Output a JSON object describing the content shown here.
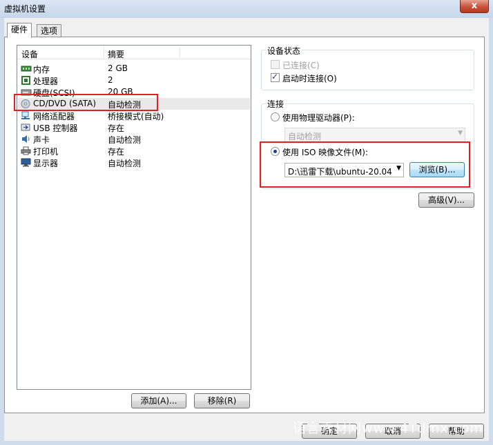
{
  "window": {
    "title": "虚拟机设置",
    "close": "x"
  },
  "tabs": [
    {
      "label": "硬件"
    },
    {
      "label": "选项"
    }
  ],
  "device_list": {
    "headers": {
      "device": "设备",
      "summary": "摘要"
    },
    "rows": [
      {
        "icon": "memory-icon",
        "name": "内存",
        "summary": "2 GB"
      },
      {
        "icon": "processor-icon",
        "name": "处理器",
        "summary": "2"
      },
      {
        "icon": "hard-disk-icon",
        "name": "硬盘(SCSI)",
        "summary": "20 GB"
      },
      {
        "icon": "cd-dvd-icon",
        "name": "CD/DVD (SATA)",
        "summary": "自动检测"
      },
      {
        "icon": "network-adapter-icon",
        "name": "网络适配器",
        "summary": "桥接模式(自动)"
      },
      {
        "icon": "usb-controller-icon",
        "name": "USB 控制器",
        "summary": "存在"
      },
      {
        "icon": "sound-card-icon",
        "name": "声卡",
        "summary": "自动检测"
      },
      {
        "icon": "printer-icon",
        "name": "打印机",
        "summary": "存在"
      },
      {
        "icon": "display-icon",
        "name": "显示器",
        "summary": "自动检测"
      }
    ],
    "selected": "CD/DVD (SATA)"
  },
  "list_buttons": {
    "add": "添加(A)...",
    "remove": "移除(R)"
  },
  "device_status": {
    "title": "设备状态",
    "connected": {
      "label": "已连接(C)",
      "checked": false,
      "disabled": true
    },
    "connect_at_power_on": {
      "label": "启动时连接(O)",
      "checked": true
    }
  },
  "connection": {
    "title": "连接",
    "physical": {
      "label": "使用物理驱动器(P):",
      "selected": false,
      "value": "自动检测"
    },
    "iso": {
      "label": "使用 ISO 映像文件(M):",
      "selected": true,
      "value": "D:\\迅雷下载\\ubuntu-20.04.:",
      "browse": "浏览(B)..."
    }
  },
  "advanced_button": "高级(V)...",
  "footer": {
    "ok": "确定",
    "cancel": "取消",
    "help": "帮助"
  },
  "watermark": "语言素材网www.4Tdmx.com",
  "colors": {
    "highlight": "#e02020",
    "selection": "#e9e9e9",
    "title_bar": "#c6d6ea"
  }
}
